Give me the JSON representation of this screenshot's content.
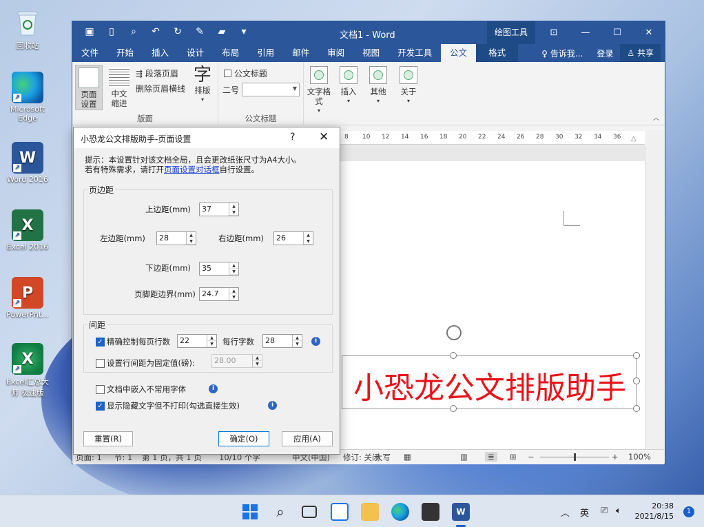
{
  "desktop": {
    "icons": [
      {
        "label": "回收站",
        "icon": "recycle-bin-icon"
      },
      {
        "label": "Microsoft Edge",
        "icon": "edge-icon"
      },
      {
        "label": "Word 2016",
        "icon": "word-icon",
        "glyph": "W"
      },
      {
        "label": "Excel 2016",
        "icon": "excel-icon",
        "glyph": "X"
      },
      {
        "label": "PowerPnt...",
        "icon": "powerpoint-icon",
        "glyph": "P"
      },
      {
        "label": "Excel汇总大师 极速版",
        "icon": "excel-master-icon",
        "glyph": "X"
      }
    ]
  },
  "word": {
    "title": "文档1 - Word",
    "context_tools": "绘图工具",
    "tabs": [
      "文件",
      "开始",
      "插入",
      "设计",
      "布局",
      "引用",
      "邮件",
      "审阅",
      "视图",
      "开发工具",
      "公文",
      "格式"
    ],
    "active_tab": "公文",
    "tell_me": "告诉我...",
    "login": "登录",
    "share": "共享",
    "ribbon": {
      "page_setup": "页面\n设置",
      "cn_indent": "中文\n缩进",
      "para_header": "段落页眉",
      "del_header_line": "删除页眉横线",
      "typeset_char": "字",
      "typeset": "排版",
      "group_layout": "版面",
      "doc_title_chk": "公文标题",
      "level_label": "二号",
      "group_doc_title": "公文标题",
      "text_format": "文字格\n式",
      "insert": "插入",
      "other": "其他",
      "about": "关于"
    },
    "ruler_ticks": [
      "8",
      "10",
      "12",
      "14",
      "16",
      "18",
      "20",
      "22",
      "24",
      "26",
      "28",
      "30",
      "32",
      "34",
      "36"
    ],
    "document_text": "小恐龙公文排版助手",
    "status": {
      "page": "页面: 1",
      "section": "节: 1",
      "page_of": "第 1 页，共 1 页",
      "words": "10/10 个字",
      "lang": "中文(中国)",
      "revise": "修订: 关闭",
      "caps": "大写",
      "zoom": "100%"
    }
  },
  "dialog": {
    "title": "小恐龙公文排版助手-页面设置",
    "help": "?",
    "tip_line1": "提示：本设置针对该文档全局，且会更改纸张尺寸为A4大小。",
    "tip_line2_pre": "若有特殊需求，请打开",
    "tip_link": "页面设置对话框",
    "tip_line2_post": "自行设置。",
    "margins": {
      "legend": "页边距",
      "top_label": "上边距(mm)",
      "top": "37",
      "left_label": "左边距(mm)",
      "left": "28",
      "right_label": "右边距(mm)",
      "right": "26",
      "bottom_label": "下边距(mm)",
      "bottom": "35",
      "footer_label": "页脚距边界(mm)",
      "footer": "24.7"
    },
    "spacing": {
      "legend": "间距",
      "exact_lines_label": "精确控制每页行数",
      "exact_lines_checked": true,
      "lines": "22",
      "chars_label": "每行字数",
      "chars": "28",
      "fixed_spacing_label": "设置行间距为固定值(磅):",
      "fixed_spacing_checked": false,
      "fixed_value": "28.00"
    },
    "embed_fonts_label": "文档中嵌入不常用字体",
    "embed_fonts_checked": false,
    "show_hidden_label": "显示隐藏文字但不打印(勾选直接生效)",
    "show_hidden_checked": true,
    "reset": "重置(R)",
    "ok": "确定(O)",
    "apply": "应用(A)"
  },
  "taskbar": {
    "ime": "英",
    "time": "20:38",
    "date": "2021/8/15",
    "notifications": "1"
  }
}
